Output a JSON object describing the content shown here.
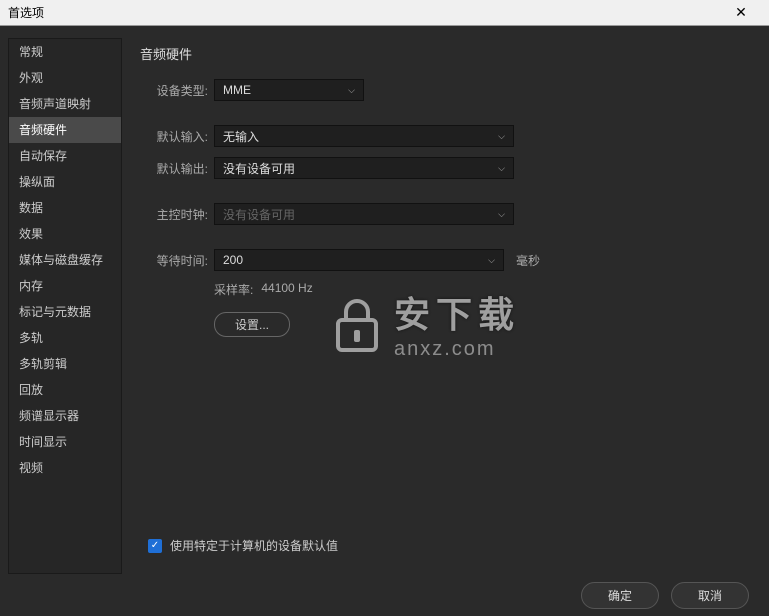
{
  "window": {
    "title": "首选项"
  },
  "sidebar": {
    "items": [
      {
        "label": "常规"
      },
      {
        "label": "外观"
      },
      {
        "label": "音频声道映射"
      },
      {
        "label": "音频硬件"
      },
      {
        "label": "自动保存"
      },
      {
        "label": "操纵面"
      },
      {
        "label": "数据"
      },
      {
        "label": "效果"
      },
      {
        "label": "媒体与磁盘缓存"
      },
      {
        "label": "内存"
      },
      {
        "label": "标记与元数据"
      },
      {
        "label": "多轨"
      },
      {
        "label": "多轨剪辑"
      },
      {
        "label": "回放"
      },
      {
        "label": "频谱显示器"
      },
      {
        "label": "时间显示"
      },
      {
        "label": "视频"
      }
    ],
    "activeIndex": 3
  },
  "panel": {
    "title": "音频硬件",
    "deviceType": {
      "label": "设备类型:",
      "value": "MME"
    },
    "defaultInput": {
      "label": "默认输入:",
      "value": "无输入"
    },
    "defaultOutput": {
      "label": "默认输出:",
      "value": "没有设备可用"
    },
    "masterClock": {
      "label": "主控时钟:",
      "value": "没有设备可用"
    },
    "latency": {
      "label": "等待时间:",
      "value": "200",
      "suffix": "毫秒"
    },
    "sampleRate": {
      "label": "采样率:",
      "value": "44100 Hz"
    },
    "settingsButton": "设置...",
    "checkbox": {
      "label": "使用特定于计算机的设备默认值",
      "checked": true
    }
  },
  "footer": {
    "ok": "确定",
    "cancel": "取消"
  },
  "watermark": {
    "cn": "安下载",
    "en": "anxz.com"
  }
}
